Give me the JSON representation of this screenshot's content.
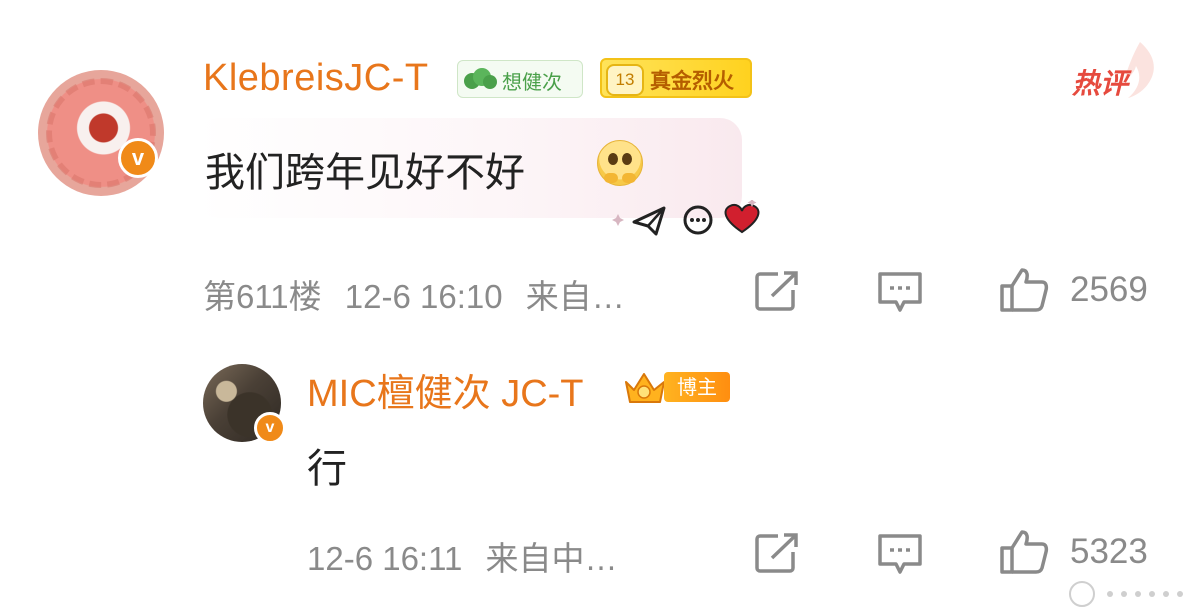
{
  "comments": [
    {
      "username": "KlebreisJC-T",
      "fan_badge": "想健次",
      "level": "13",
      "level_title": "真金烈火",
      "hot_tag": "热评",
      "text": "我们跨年见好不好",
      "floor": "第611楼",
      "time": "12-6 16:10",
      "source": "来自…",
      "likes": "2569"
    }
  ],
  "reply": {
    "username": "MIC檀健次 JC-T",
    "role_badge": "博主",
    "text": "行",
    "time": "12-6 16:11",
    "source": "来自中…",
    "likes": "5323"
  },
  "icons": {
    "verified": "verified-v-icon",
    "share": "share-icon",
    "comment": "comment-icon",
    "like": "thumbs-up-icon",
    "emoji": "pleading-face-emoji",
    "crown": "crown-icon",
    "send": "paper-plane-icon",
    "heart": "heart-icon"
  },
  "colors": {
    "username": "#e8761b",
    "hot": "#e64a3e",
    "meta": "#8a8a8a",
    "fan_badge": "#4aa04a",
    "level_badge": "#ffd21f",
    "verified": "#f08a18"
  }
}
